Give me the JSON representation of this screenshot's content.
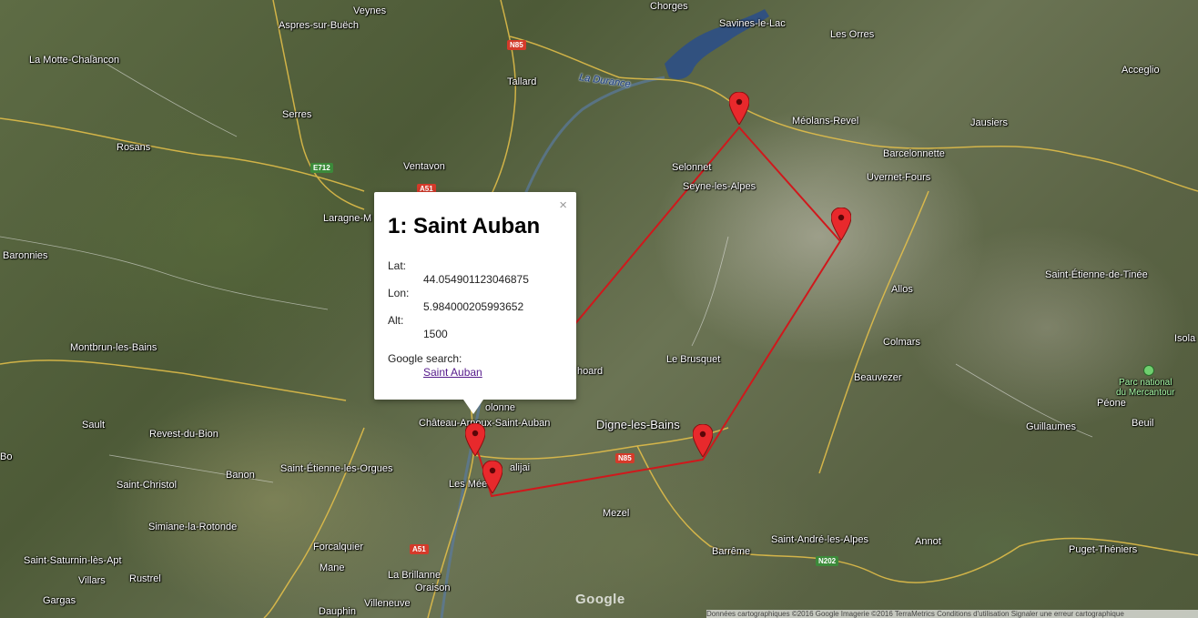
{
  "map": {
    "place_labels": [
      {
        "id": "veynes",
        "text": "Veynes"
      },
      {
        "id": "chorges",
        "text": "Chorges"
      },
      {
        "id": "savines",
        "text": "Savines-le-Lac"
      },
      {
        "id": "lesorres",
        "text": "Les Orres"
      },
      {
        "id": "acceglio",
        "text": "Acceglio"
      },
      {
        "id": "aspres",
        "text": "Aspres-sur-Buëch"
      },
      {
        "id": "lamotte",
        "text": "La Motte-Chalancon"
      },
      {
        "id": "tallard",
        "text": "Tallard"
      },
      {
        "id": "serres",
        "text": "Serres"
      },
      {
        "id": "meolans",
        "text": "Méolans-Revel"
      },
      {
        "id": "jausiers",
        "text": "Jausiers"
      },
      {
        "id": "rosans",
        "text": "Rosans"
      },
      {
        "id": "barcelonnette",
        "text": "Barcelonnette"
      },
      {
        "id": "selonnet",
        "text": "Selonnet"
      },
      {
        "id": "uvernet",
        "text": "Uvernet-Fours"
      },
      {
        "id": "ventavon",
        "text": "Ventavon"
      },
      {
        "id": "seyne",
        "text": "Seyne-les-Alpes"
      },
      {
        "id": "laragne",
        "text": "Laragne-M"
      },
      {
        "id": "baronnies",
        "text": "Baronnies"
      },
      {
        "id": "saintetienne",
        "text": "Saint-Étienne-de-Tinée"
      },
      {
        "id": "allos",
        "text": "Allos"
      },
      {
        "id": "montbrun",
        "text": "Montbrun-les-Bains"
      },
      {
        "id": "colmars",
        "text": "Colmars"
      },
      {
        "id": "isola",
        "text": "Isola"
      },
      {
        "id": "lebrusquet",
        "text": "Le Brusquet"
      },
      {
        "id": "choard",
        "text": "hoard"
      },
      {
        "id": "beauvezer",
        "text": "Beauvezer"
      },
      {
        "id": "peone",
        "text": "Péone"
      },
      {
        "id": "volonne",
        "text": "olonne"
      },
      {
        "id": "chateau",
        "text": "Château-Arnoux-Saint-Auban"
      },
      {
        "id": "digne",
        "text": "Digne-les-Bains"
      },
      {
        "id": "sault",
        "text": "Sault"
      },
      {
        "id": "revest",
        "text": "Revest-du-Bion"
      },
      {
        "id": "guillaumes",
        "text": "Guillaumes"
      },
      {
        "id": "beuil",
        "text": "Beuil"
      },
      {
        "id": "malijai",
        "text": "alijai"
      },
      {
        "id": "banon",
        "text": "Banon"
      },
      {
        "id": "saintetienneorgues",
        "text": "Saint-Étienne-les-Orgues"
      },
      {
        "id": "lesmees",
        "text": "Les Mées"
      },
      {
        "id": "saintchristol",
        "text": "Saint-Christol"
      },
      {
        "id": "mezel",
        "text": "Mezel"
      },
      {
        "id": "simiane",
        "text": "Simiane-la-Rotonde"
      },
      {
        "id": "forcalquier",
        "text": "Forcalquier"
      },
      {
        "id": "barreme",
        "text": "Barrême"
      },
      {
        "id": "saintandre",
        "text": "Saint-André-les-Alpes"
      },
      {
        "id": "annot",
        "text": "Annot"
      },
      {
        "id": "saintsaturnin",
        "text": "Saint-Saturnin-lès-Apt"
      },
      {
        "id": "puget",
        "text": "Puget-Théniers"
      },
      {
        "id": "mane",
        "text": "Mane"
      },
      {
        "id": "villars",
        "text": "Villars"
      },
      {
        "id": "rustrel",
        "text": "Rustrel"
      },
      {
        "id": "labrillanne",
        "text": "La Brillanne"
      },
      {
        "id": "oraison",
        "text": "Oraison"
      },
      {
        "id": "gargas",
        "text": "Gargas"
      },
      {
        "id": "dauphin",
        "text": "Dauphin"
      },
      {
        "id": "villeneuve",
        "text": "Villeneuve"
      },
      {
        "id": "bo",
        "text": "Bo"
      }
    ],
    "water_labels": [
      {
        "id": "durance",
        "text": "La Durance"
      }
    ],
    "park_label": "Parc national\ndu Mercantour",
    "road_shields": [
      {
        "id": "n85a",
        "text": "N85",
        "color": "red"
      },
      {
        "id": "e712",
        "text": "E712",
        "color": "green"
      },
      {
        "id": "a51a",
        "text": "A51",
        "color": "red"
      },
      {
        "id": "n85b",
        "text": "N85",
        "color": "red"
      },
      {
        "id": "a51b",
        "text": "A51",
        "color": "red"
      },
      {
        "id": "n202",
        "text": "N202",
        "color": "green"
      }
    ],
    "route_color": "#d0181c",
    "marker_color": "#e8292c",
    "google_logo": "Google",
    "attribution": "Données cartographiques ©2016 Google Imagerie ©2016 TerraMetrics   Conditions d'utilisation   Signaler une erreur cartographique"
  },
  "popup": {
    "title": "1: Saint Auban",
    "close_symbol": "×",
    "lat_label": "Lat:",
    "lat_value": "44.054901123046875",
    "lon_label": "Lon:",
    "lon_value": "5.984000205993652",
    "alt_label": "Alt:",
    "alt_value": "1500",
    "search_label": "Google search:",
    "search_link": "Saint Auban"
  }
}
